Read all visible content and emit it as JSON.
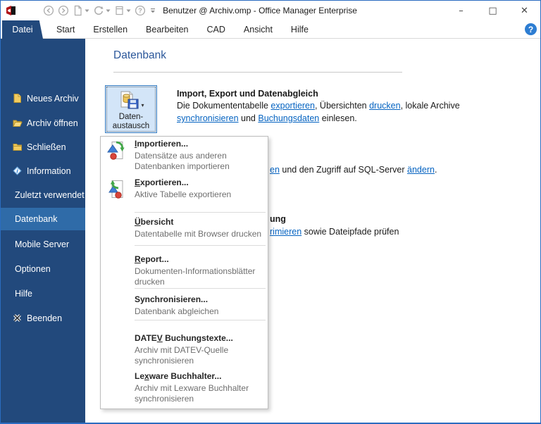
{
  "titlebar": {
    "title": "Benutzer @ Archiv.omp - Office Manager Enterprise",
    "app_icon": "office-manager-logo-icon",
    "qat_icons": [
      "back-icon",
      "forward-icon",
      "new-document-icon",
      "refresh-icon",
      "window-icon",
      "help-circle-icon",
      "qat-customize-icon"
    ],
    "controls": {
      "minimize": "–",
      "maximize": "□",
      "close": "✕"
    }
  },
  "ribbon_tabs": {
    "active": "Datei",
    "items": [
      "Datei",
      "Start",
      "Erstellen",
      "Bearbeiten",
      "CAD",
      "Ansicht",
      "Hilfe"
    ],
    "help_badge": "?"
  },
  "sidebar": {
    "items": [
      {
        "label": "Neues Archiv",
        "icon": "new-archive-icon"
      },
      {
        "label": "Archiv öffnen",
        "icon": "open-archive-icon"
      },
      {
        "label": "Schließen",
        "icon": "close-archive-icon"
      },
      {
        "label": "Information",
        "icon": "information-icon"
      },
      {
        "label": "Zuletzt verwendet"
      },
      {
        "label": "Datenbank",
        "selected": true
      },
      {
        "label": "Mobile Server"
      },
      {
        "label": "Optionen"
      },
      {
        "label": "Hilfe"
      },
      {
        "label": "Beenden",
        "icon": "exit-icon"
      }
    ]
  },
  "page": {
    "title": "Datenbank",
    "exchange_button": {
      "line1": "Daten-",
      "line2": "austausch",
      "icon": "data-exchange-icon",
      "caret": "▾"
    },
    "intro": {
      "heading": "Import, Export und Datenabgleich",
      "line1": [
        {
          "t": "Die Dokumententabelle "
        },
        {
          "t": "exportieren",
          "link": true,
          "name": "link-exportieren"
        },
        {
          "t": ", Übersichten "
        },
        {
          "t": "drucken",
          "link": true,
          "name": "link-drucken"
        },
        {
          "t": ", lokale Archive"
        }
      ],
      "line2": [
        {
          "t": "synchronisieren",
          "link": true,
          "name": "link-synchronisieren"
        },
        {
          "t": " und "
        },
        {
          "t": "Buchungsdaten",
          "link": true,
          "name": "link-buchungsdaten"
        },
        {
          "t": " einlesen."
        }
      ]
    },
    "partial_sql_row": [
      {
        "t": "en",
        "link": true,
        "name": "link-partial-en"
      },
      {
        "t": " und den Zugriff auf SQL-Server "
      },
      {
        "t": "ändern",
        "link": true,
        "name": "link-aendern"
      },
      {
        "t": "."
      }
    ],
    "partial_reorg_heading": "ung",
    "partial_reorg_row": [
      {
        "t": "rimieren",
        "link": true,
        "name": "link-partial-rimieren"
      },
      {
        "t": " sowie Dateipfade prüfen"
      }
    ]
  },
  "menu": {
    "items": [
      {
        "pre": "",
        "u": "I",
        "post": "mportieren...",
        "subtitle": "Datensätze aus anderen\nDatenbanken importieren",
        "icon": "import-icon"
      },
      {
        "pre": "",
        "u": "E",
        "post": "xportieren...",
        "subtitle": "Aktive Tabelle exportieren",
        "icon": "export-icon"
      },
      {
        "pre": "",
        "u": "Ü",
        "post": "bersicht",
        "subtitle": "Datentabelle mit Browser drucken"
      },
      {
        "pre": "",
        "u": "R",
        "post": "eport...",
        "subtitle": "Dokumenten-Informationsblätter\ndrucken"
      },
      {
        "pre": "Synchronisieren...",
        "u": "",
        "post": "",
        "subtitle": "Datenbank abgleichen"
      },
      {
        "pre": "DATE",
        "u": "V",
        "post": " Buchungstexte...",
        "subtitle": "Archiv mit DATEV-Quelle\nsynchronisieren"
      },
      {
        "pre": "Le",
        "u": "x",
        "post": "ware Buchhalter...",
        "subtitle": "Archiv mit Lexware Buchhalter\nsynchronisieren"
      }
    ]
  },
  "colors": {
    "window_border": "#2B6CC0",
    "sidebar_bg": "#22497C",
    "sidebar_selected_bg": "#2F6BA8",
    "tab_active_bg": "#22497C",
    "heading_blue": "#2B579A",
    "link_blue": "#0563C1",
    "button_bg": "#D3E5F8",
    "button_border": "#3C7FC0",
    "help_badge_bg": "#2D7DD2"
  }
}
